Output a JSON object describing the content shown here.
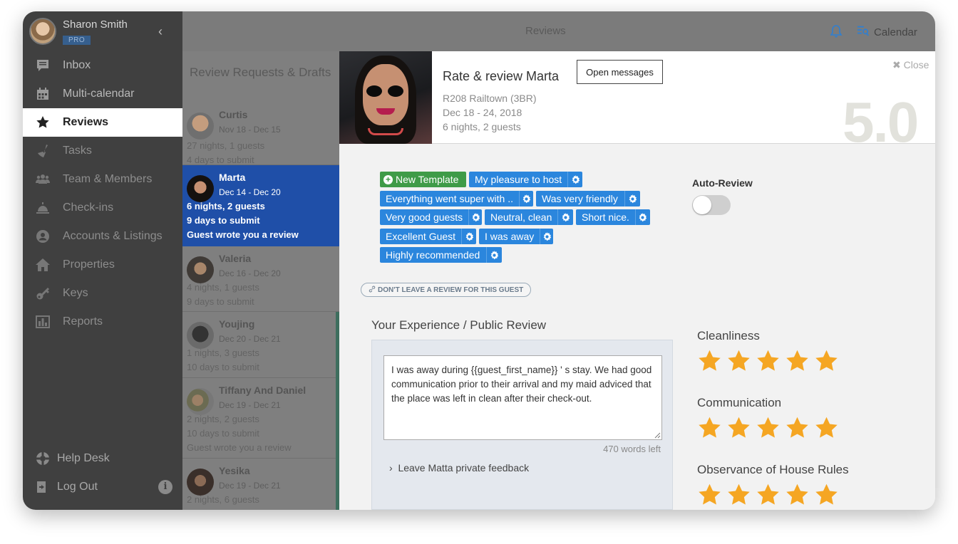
{
  "user": {
    "name": "Sharon Smith",
    "badge": "PRO"
  },
  "nav": {
    "items": [
      {
        "label": "Inbox",
        "icon": "inbox-icon"
      },
      {
        "label": "Multi-calendar",
        "icon": "calendar-icon"
      },
      {
        "label": "Reviews",
        "icon": "star-icon"
      },
      {
        "label": "Tasks",
        "icon": "broom-icon"
      },
      {
        "label": "Team & Members",
        "icon": "team-icon"
      },
      {
        "label": "Check-ins",
        "icon": "bell-hop-icon"
      },
      {
        "label": "Accounts & Listings",
        "icon": "user-circle-icon"
      },
      {
        "label": "Properties",
        "icon": "home-icon"
      },
      {
        "label": "Keys",
        "icon": "key-icon"
      },
      {
        "label": "Reports",
        "icon": "bar-chart-icon"
      }
    ],
    "help": "Help Desk",
    "logout": "Log Out"
  },
  "topbar": {
    "title": "Reviews",
    "calendar": "Calendar"
  },
  "requests": {
    "heading": "Review Requests & Drafts",
    "items": [
      {
        "name": "Curtis",
        "dates": "Nov 18 - Dec 15",
        "line1": "27 nights, 1 guests",
        "line2": "4 days to submit",
        "line3": ""
      },
      {
        "name": "Marta",
        "dates": "Dec 14 - Dec 20",
        "line1": "6 nights, 2 guests",
        "line2": "9 days to submit",
        "line3": "Guest wrote you a review"
      },
      {
        "name": "Valeria",
        "dates": "Dec 16 - Dec 20",
        "line1": "4 nights, 1 guests",
        "line2": "9 days to submit",
        "line3": ""
      },
      {
        "name": "Youjing",
        "dates": "Dec 20 - Dec 21",
        "line1": "1 nights, 3 guests",
        "line2": "10 days to submit",
        "line3": ""
      },
      {
        "name": "Tiffany And Daniel",
        "dates": "Dec 19 - Dec 21",
        "line1": "2 nights, 2 guests",
        "line2": "10 days to submit",
        "line3": "Guest wrote you a review"
      },
      {
        "name": "Yesika",
        "dates": "Dec 19 - Dec 21",
        "line1": "2 nights, 6 guests",
        "line2": "",
        "line3": ""
      }
    ]
  },
  "guest": {
    "title": "Rate & review Marta",
    "open_messages": "Open messages",
    "property": "R208 Railtown (3BR)",
    "dates": "Dec 18 - 24, 2018",
    "stay": "6 nights, 2 guests",
    "close": "Close",
    "score": "5.0"
  },
  "templates": {
    "new": "New Template",
    "tags": [
      "My pleasure to host",
      "Everything went super with ..",
      "Was very friendly",
      "Very good guests",
      "Neutral, clean",
      "Short nice.",
      "Excellent Guest",
      "I was away",
      "Highly recommended"
    ]
  },
  "auto_review": {
    "label": "Auto-Review",
    "enabled": false
  },
  "dont_leave": "DON'T LEAVE A REVIEW FOR THIS GUEST",
  "review": {
    "title": "Your Experience / Public Review",
    "text": "I was away during {{guest_first_name}} ' s stay. We had good communication prior to their arrival and my maid adviced that the place was left in clean after their check-out.",
    "words_left": "470 words left",
    "private_feedback": "Leave Matta private feedback"
  },
  "ratings": [
    {
      "label": "Cleanliness",
      "stars": 5
    },
    {
      "label": "Communication",
      "stars": 5
    },
    {
      "label": "Observance of House Rules",
      "stars": 5
    }
  ],
  "colors": {
    "accent": "#2b86dd",
    "selected": "#1f4fa8",
    "star": "#f5a623",
    "green": "#3f9b48"
  }
}
